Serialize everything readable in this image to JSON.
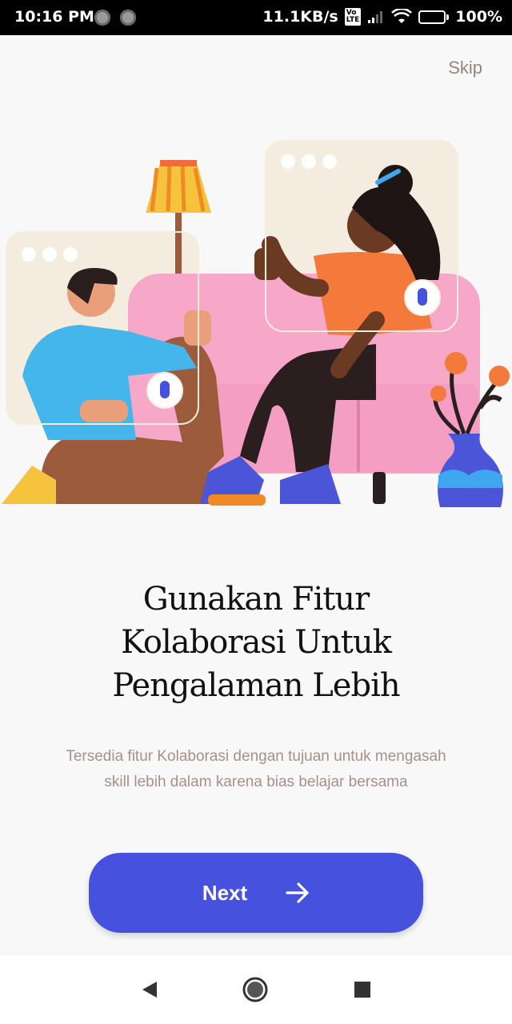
{
  "status_bar": {
    "time": "10:16 PM",
    "network_speed": "11.1KB/s",
    "volte": "VoLTE",
    "battery_percent": "100%",
    "battery_level": 1.0
  },
  "header": {
    "skip_label": "Skip"
  },
  "onboarding": {
    "title_lines": [
      "Gunakan Fitur",
      "Kolaborasi Untuk",
      "Pengalaman Lebih"
    ],
    "description": "Tersedia fitur Kolaborasi dengan tujuan untuk mengasah skill lebih dalam karena bias belajar bersama",
    "next_label": "Next",
    "next_icon": "arrow-right-icon"
  },
  "nav_bar": {
    "back_icon": "back-triangle-icon",
    "home_icon": "home-circle-icon",
    "recents_icon": "recents-square-icon"
  },
  "colors": {
    "primary": "#4651dd",
    "skip_text": "#9a8478",
    "description_text": "#a89088",
    "background": "#f8f8f8"
  }
}
